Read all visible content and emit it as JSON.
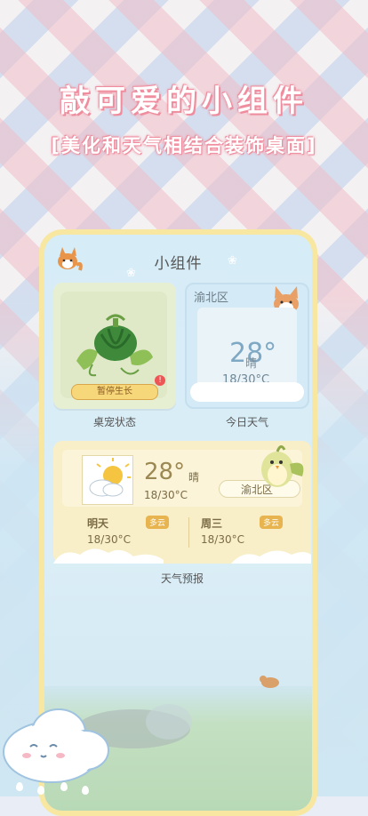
{
  "header": {
    "headline": "敲可爱的小组件",
    "subline": "[美化和天气相结合装饰桌面]"
  },
  "screen": {
    "title": "小组件",
    "pet_widget": {
      "status_badge": "暂停生长",
      "alert": "!",
      "caption": "桌宠状态"
    },
    "weather_widget": {
      "location": "渝北区",
      "temperature": "28°",
      "condition": "晴",
      "range": "18/30°C",
      "caption": "今日天气"
    },
    "forecast_widget": {
      "temperature": "28°",
      "condition": "晴",
      "range": "18/30°C",
      "location": "渝北区",
      "days": [
        {
          "name": "明天",
          "tag": "多云",
          "range": "18/30°C"
        },
        {
          "name": "周三",
          "tag": "多云",
          "range": "18/30°C"
        }
      ],
      "caption": "天气预报"
    }
  },
  "icons": {
    "fox": "fox-icon",
    "watermelon": "watermelon-icon",
    "corgi": "corgi-icon",
    "sun": "sun-cloud-icon",
    "bird": "bird-icon",
    "cloud_mascot": "cloud-mascot-icon"
  },
  "colors": {
    "headline_outline": "#f08fa0",
    "phone_frame": "#f7e7a1",
    "tag": "#e7b44f"
  }
}
